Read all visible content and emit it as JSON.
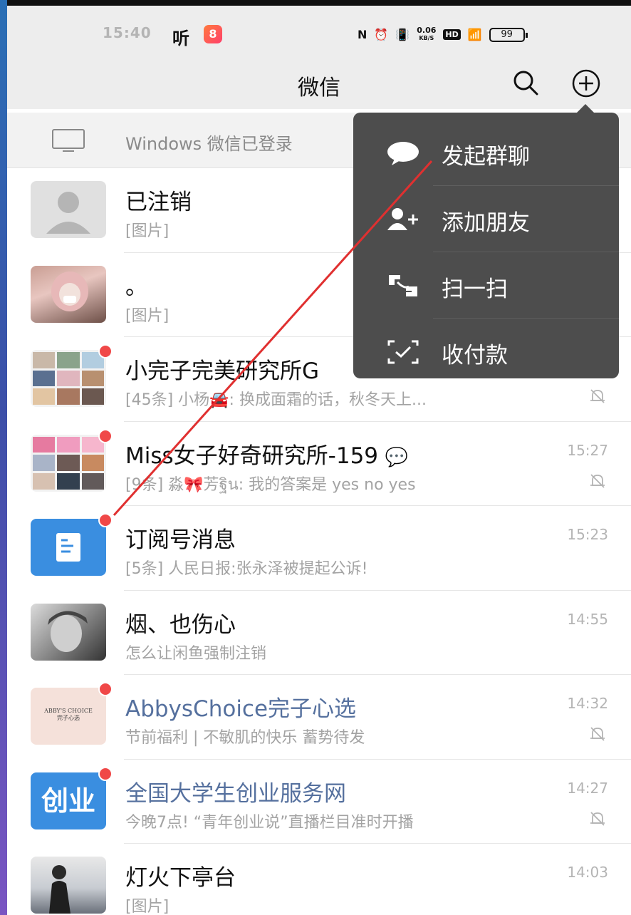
{
  "status_bar": {
    "time": "15:40",
    "ting": "听",
    "speed": "0.06",
    "speed_unit": "KB/S",
    "battery": "99"
  },
  "header": {
    "title": "微信"
  },
  "banner": {
    "text": "Windows 微信已登录"
  },
  "menu": {
    "items": [
      {
        "label": "发起群聊",
        "icon": "chat-bubble-icon"
      },
      {
        "label": "添加朋友",
        "icon": "add-friend-icon"
      },
      {
        "label": "扫一扫",
        "icon": "scan-icon"
      },
      {
        "label": "收付款",
        "icon": "payment-icon"
      }
    ]
  },
  "chats": [
    {
      "name": "已注销",
      "preview": "[图片]",
      "time": "",
      "muted": false,
      "unread": false
    },
    {
      "name": "。",
      "preview": "[图片]",
      "time": "",
      "muted": false,
      "unread": false
    },
    {
      "name": "小完子完美研究所G",
      "preview": "[45条] 小杨🚘: 换成面霜的话，秋冬天上...",
      "time": "",
      "muted": true,
      "unread": true
    },
    {
      "name": "Miss女子好奇研究所-159",
      "preview": "[9条] 淼🎀芳ฐิน: 我的答案是 yes no yes",
      "time": "15:27",
      "muted": true,
      "unread": true
    },
    {
      "name": "订阅号消息",
      "preview": "[5条] 人民日报:张永泽被提起公诉!",
      "time": "15:23",
      "muted": false,
      "unread": true
    },
    {
      "name": "烟、也伤心",
      "preview": "怎么让闲鱼强制注销",
      "time": "14:55",
      "muted": false,
      "unread": false
    },
    {
      "name": "AbbysChoice完子心选",
      "preview": "节前福利 | 不敏肌的快乐 蓄势待发",
      "time": "14:32",
      "muted": true,
      "unread": true,
      "avatar_text": "ABBY'S CHOICE",
      "avatar_sub": "完子心选"
    },
    {
      "name": "全国大学生创业服务网",
      "preview": "今晚7点! “青年创业说”直播栏目准时开播",
      "time": "14:27",
      "muted": true,
      "unread": true,
      "avatar_text": "创业"
    },
    {
      "name": "灯火下亭台",
      "preview": "[图片]",
      "time": "14:03",
      "muted": false,
      "unread": false
    }
  ],
  "colors": {
    "header_bg": "#ededed",
    "menu_bg": "#4d4d4d",
    "unread_dot": "#f04848",
    "official_name": "#55709e",
    "annotation_line": "#e03030"
  }
}
